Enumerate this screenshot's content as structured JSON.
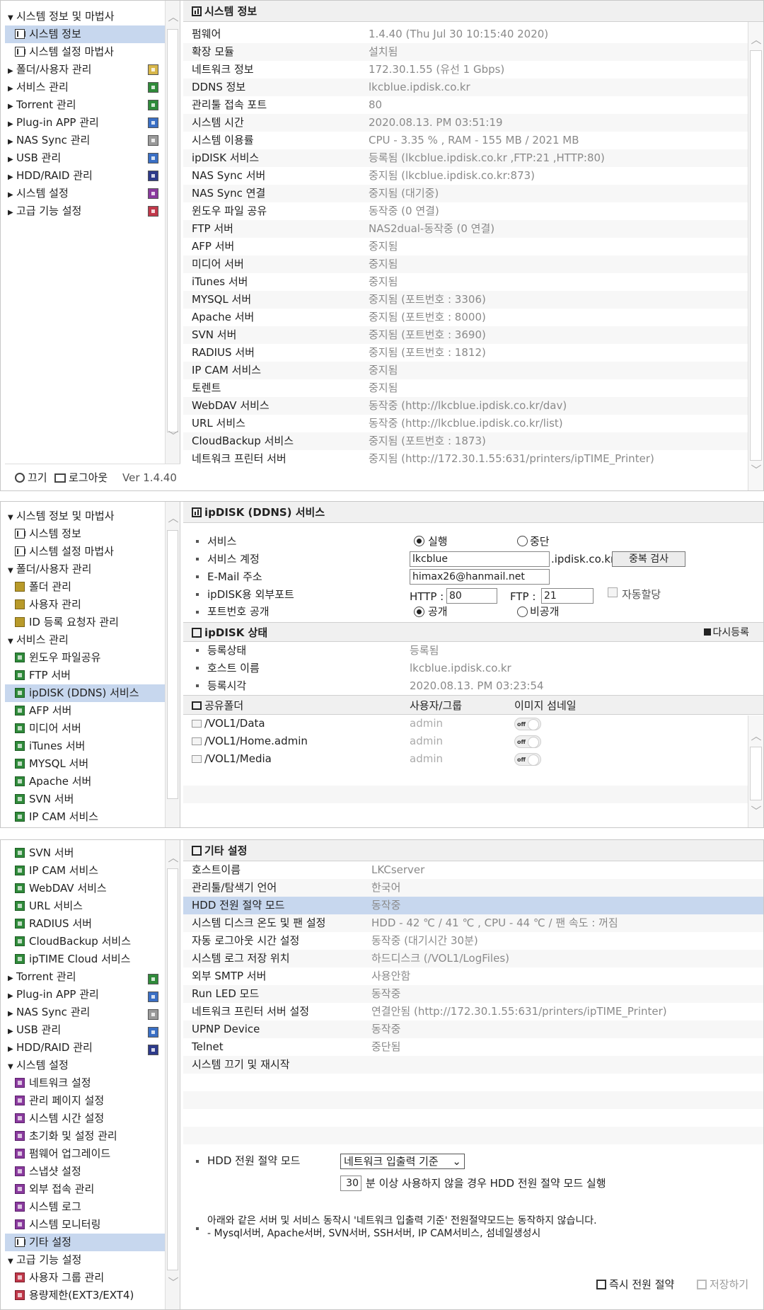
{
  "panel1": {
    "sidebar": [
      {
        "label": "시스템 정보 및 마법사",
        "type": "group"
      },
      {
        "label": "시스템 정보",
        "type": "child",
        "selected": true
      },
      {
        "label": "시스템 설정 마법사",
        "type": "child"
      },
      {
        "label": "폴더/사용자 관리",
        "type": "collapsed"
      },
      {
        "label": "서비스 관리",
        "type": "collapsed"
      },
      {
        "label": "Torrent 관리",
        "type": "collapsed"
      },
      {
        "label": "Plug-in APP 관리",
        "type": "collapsed"
      },
      {
        "label": "NAS Sync 관리",
        "type": "collapsed"
      },
      {
        "label": "USB 관리",
        "type": "collapsed"
      },
      {
        "label": "HDD/RAID 관리",
        "type": "collapsed"
      },
      {
        "label": "시스템 설정",
        "type": "collapsed"
      },
      {
        "label": "고급 기능 설정",
        "type": "collapsed"
      }
    ],
    "footer": {
      "power": "끄기",
      "logout": "로그아웃",
      "version": "Ver 1.4.40"
    },
    "title": "시스템 정보",
    "rows": [
      {
        "k": "펌웨어",
        "v": "1.4.40 (Thu Jul 30 10:15:40 2020)"
      },
      {
        "k": "확장 모듈",
        "v": "설치됨"
      },
      {
        "k": "네트워크 정보",
        "v": "172.30.1.55 (유선 1 Gbps)"
      },
      {
        "k": "DDNS 정보",
        "v": "lkcblue.ipdisk.co.kr"
      },
      {
        "k": "관리툴 접속 포트",
        "v": "80"
      },
      {
        "k": "시스템 시간",
        "v": "2020.08.13. PM 03:51:19"
      },
      {
        "k": "시스템 이용률",
        "v": "CPU - 3.35 % , RAM - 155 MB / 2021 MB"
      },
      {
        "k": "ipDISK 서비스",
        "v": "등록됨 (lkcblue.ipdisk.co.kr ,FTP:21 ,HTTP:80)"
      },
      {
        "k": "NAS Sync 서버",
        "v": "중지됨 (lkcblue.ipdisk.co.kr:873)"
      },
      {
        "k": "NAS Sync 연결",
        "v": "중지됨 (대기중)"
      },
      {
        "k": "윈도우 파일 공유",
        "v": "동작중 (0 연결)"
      },
      {
        "k": "FTP 서버",
        "v": "NAS2dual-동작중 (0 연결)"
      },
      {
        "k": "AFP 서버",
        "v": "중지됨"
      },
      {
        "k": "미디어 서버",
        "v": "중지됨"
      },
      {
        "k": "iTunes 서버",
        "v": "중지됨"
      },
      {
        "k": "MYSQL 서버",
        "v": "중지됨 (포트번호 : 3306)"
      },
      {
        "k": "Apache 서버",
        "v": "중지됨 (포트번호 : 8000)"
      },
      {
        "k": "SVN 서버",
        "v": "중지됨 (포트번호 : 3690)"
      },
      {
        "k": "RADIUS 서버",
        "v": "중지됨 (포트번호 : 1812)"
      },
      {
        "k": "IP CAM 서비스",
        "v": "중지됨"
      },
      {
        "k": "토렌트",
        "v": "중지됨"
      },
      {
        "k": "WebDAV 서비스",
        "v": "동작중 (http://lkcblue.ipdisk.co.kr/dav)"
      },
      {
        "k": "URL 서비스",
        "v": "동작중 (http://lkcblue.ipdisk.co.kr/list)"
      },
      {
        "k": "CloudBackup 서비스",
        "v": "중지됨 (포트번호 : 1873)"
      },
      {
        "k": "네트워크 프린터 서버",
        "v": "중지됨 (http://172.30.1.55:631/printers/ipTIME_Printer)"
      }
    ]
  },
  "panel2": {
    "sidebar": [
      {
        "label": "시스템 정보 및 마법사",
        "type": "group"
      },
      {
        "label": "시스템 정보",
        "type": "child"
      },
      {
        "label": "시스템 설정 마법사",
        "type": "child"
      },
      {
        "label": "폴더/사용자 관리",
        "type": "group"
      },
      {
        "label": "폴더 관리",
        "type": "child"
      },
      {
        "label": "사용자 관리",
        "type": "child"
      },
      {
        "label": "ID 등록 요청자 관리",
        "type": "child"
      },
      {
        "label": "서비스 관리",
        "type": "group"
      },
      {
        "label": "윈도우 파일공유",
        "type": "child"
      },
      {
        "label": "FTP 서버",
        "type": "child"
      },
      {
        "label": "ipDISK (DDNS) 서비스",
        "type": "child",
        "selected": true
      },
      {
        "label": "AFP 서버",
        "type": "child"
      },
      {
        "label": "미디어 서버",
        "type": "child"
      },
      {
        "label": "iTunes 서버",
        "type": "child"
      },
      {
        "label": "MYSQL 서버",
        "type": "child"
      },
      {
        "label": "Apache 서버",
        "type": "child"
      },
      {
        "label": "SVN 서버",
        "type": "child"
      },
      {
        "label": "IP CAM 서비스",
        "type": "child"
      }
    ],
    "title": "ipDISK (DDNS) 서비스",
    "form": {
      "service_label": "서비스",
      "run": "실행",
      "stop": "중단",
      "account_label": "서비스 계정",
      "account_value": "lkcblue",
      "domain_suffix": ".ipdisk.co.kr",
      "dup_check": "중복 검사",
      "email_label": "E-Mail 주소",
      "email_value": "himax26@hanmail.net",
      "port_label": "ipDISK용 외부포트",
      "http_label": "HTTP :",
      "http_value": "80",
      "ftp_label": "FTP :",
      "ftp_value": "21",
      "auto_assign": "자동할당",
      "port_public_label": "포트번호 공개",
      "public": "공개",
      "private": "비공개"
    },
    "status_title": "ipDISK 상태",
    "reregister": "다시등록",
    "status": [
      {
        "k": "등록상태",
        "v": "등록됨"
      },
      {
        "k": "호스트 이름",
        "v": "lkcblue.ipdisk.co.kr"
      },
      {
        "k": "등록시각",
        "v": "2020.08.13. PM 03:23:54"
      }
    ],
    "share_headers": {
      "folder": "공유폴더",
      "user": "사용자/그룹",
      "thumb": "이미지 섬네일"
    },
    "shares": [
      {
        "path": "/VOL1/Data",
        "user": "admin",
        "toggle": "off"
      },
      {
        "path": "/VOL1/Home.admin",
        "user": "admin",
        "toggle": "off"
      },
      {
        "path": "/VOL1/Media",
        "user": "admin",
        "toggle": "off"
      }
    ]
  },
  "panel3": {
    "sidebar": [
      {
        "label": "SVN 서버",
        "type": "child"
      },
      {
        "label": "IP CAM 서비스",
        "type": "child"
      },
      {
        "label": "WebDAV 서비스",
        "type": "child"
      },
      {
        "label": "URL 서비스",
        "type": "child"
      },
      {
        "label": "RADIUS 서버",
        "type": "child"
      },
      {
        "label": "CloudBackup 서비스",
        "type": "child"
      },
      {
        "label": "ipTIME Cloud 서비스",
        "type": "child"
      },
      {
        "label": "Torrent 관리",
        "type": "collapsed"
      },
      {
        "label": "Plug-in APP 관리",
        "type": "collapsed"
      },
      {
        "label": "NAS Sync 관리",
        "type": "collapsed"
      },
      {
        "label": "USB 관리",
        "type": "collapsed"
      },
      {
        "label": "HDD/RAID 관리",
        "type": "collapsed"
      },
      {
        "label": "시스템 설정",
        "type": "group"
      },
      {
        "label": "네트워크 설정",
        "type": "child"
      },
      {
        "label": "관리 페이지 설정",
        "type": "child"
      },
      {
        "label": "시스템 시간 설정",
        "type": "child"
      },
      {
        "label": "초기화 및 설정 관리",
        "type": "child"
      },
      {
        "label": "펌웨어 업그레이드",
        "type": "child"
      },
      {
        "label": "스냅샷 설정",
        "type": "child"
      },
      {
        "label": "외부 접속 관리",
        "type": "child"
      },
      {
        "label": "시스템 로그",
        "type": "child"
      },
      {
        "label": "시스템 모니터링",
        "type": "child"
      },
      {
        "label": "기타 설정",
        "type": "child",
        "selected": true
      },
      {
        "label": "고급 기능 설정",
        "type": "group"
      },
      {
        "label": "사용자 그룹 관리",
        "type": "child"
      },
      {
        "label": "용량제한(EXT3/EXT4)",
        "type": "child"
      }
    ],
    "title": "기타 설정",
    "rows": [
      {
        "k": "호스트이름",
        "v": "LKCserver"
      },
      {
        "k": "관리툴/탐색기 언어",
        "v": "한국어"
      },
      {
        "k": "HDD 전원 절약 모드",
        "v": "동작중",
        "selected": true
      },
      {
        "k": "시스템 디스크 온도 및 팬 설정",
        "v": "HDD - 42 ℃ / 41 ℃ , CPU - 44 ℃ / 팬 속도 : 꺼짐"
      },
      {
        "k": "자동 로그아웃 시간 설정",
        "v": "동작중 (대기시간 30분)"
      },
      {
        "k": "시스템 로그 저장 위치",
        "v": "하드디스크 (/VOL1/LogFiles)"
      },
      {
        "k": "외부 SMTP 서버",
        "v": "사용안함"
      },
      {
        "k": "Run LED 모드",
        "v": "동작중"
      },
      {
        "k": "네트워크 프린터 서버 설정",
        "v": "연결안됨 (http://172.30.1.55:631/printers/ipTIME_Printer)"
      },
      {
        "k": "UPNP Device",
        "v": "동작중"
      },
      {
        "k": "Telnet",
        "v": "중단됨"
      },
      {
        "k": "시스템 끄기 및 재시작",
        "v": ""
      }
    ],
    "hdd_label": "HDD 전원 절약 모드",
    "hdd_select": "네트워크 입출력 기준",
    "minutes_value": "30",
    "minutes_text": "분 이상 사용하지 않을 경우 HDD 전원 절약 모드 실행",
    "note1": "아래와 같은 서버 및 서비스 동작시 '네트워크 입출력 기준' 전원절약모드는 동작하지 않습니다.",
    "note2": "- Mysql서버, Apache서버, SVN서버, SSH서버, IP CAM서비스, 섬네일생성시",
    "power_now": "즉시 전원 절약",
    "save": "저장하기"
  },
  "colors": {
    "selected": "#c7d7ee",
    "header_bg": "#f0f0f0",
    "value_gray": "#8a8a8a"
  }
}
